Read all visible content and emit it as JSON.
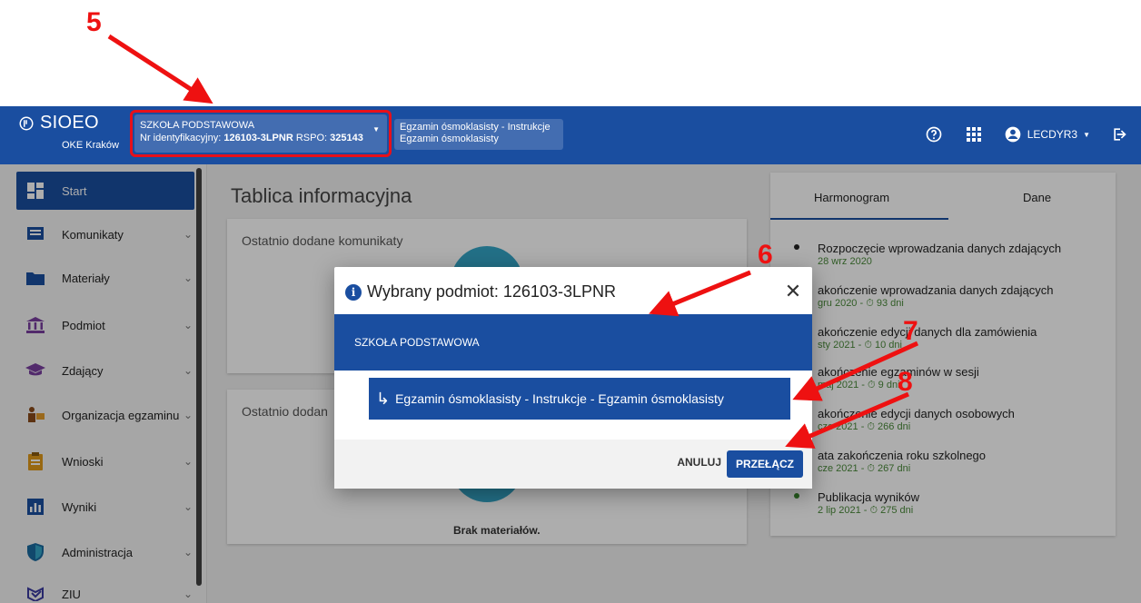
{
  "annotations": {
    "step5": "5",
    "step6": "6",
    "step7": "7",
    "step8": "8"
  },
  "header": {
    "brand": "SIOEO",
    "brand_sub": "OKE Kraków",
    "context": {
      "school_type": "SZKOŁA PODSTAWOWA",
      "id_label": "Nr identyfikacyjny:",
      "id_value": "126103-3LPNR",
      "rspo_label": "RSPO:",
      "rspo_value": "325143"
    },
    "exam_context": {
      "line1": "Egzamin ósmoklasisty - Instrukcje",
      "line2": "Egzamin ósmoklasisty"
    },
    "user": "LECDYR3"
  },
  "sidebar": {
    "items": [
      {
        "label": "Start"
      },
      {
        "label": "Komunikaty"
      },
      {
        "label": "Materiały"
      },
      {
        "label": "Podmiot"
      },
      {
        "label": "Zdający"
      },
      {
        "label": "Organizacja egzaminu"
      },
      {
        "label": "Wnioski"
      },
      {
        "label": "Wyniki"
      },
      {
        "label": "Administracja"
      },
      {
        "label": "ZIU"
      }
    ]
  },
  "main": {
    "title": "Tablica informacyjna",
    "card1_title": "Ostatnio dodane komunikaty",
    "card2_title": "Ostatnio dodan",
    "card2_empty": "Brak materiałów."
  },
  "schedule": {
    "tabs": [
      "Harmonogram",
      "Dane"
    ],
    "items": [
      {
        "title": "Rozpoczęcie wprowadzania danych zdających",
        "date": "28 wrz 2020"
      },
      {
        "title": "akończenie wprowadzania danych zdających",
        "date": "gru 2020 - ⏱ 93 dni"
      },
      {
        "title": "akończenie edycji danych dla zamówienia",
        "date": "sty 2021 - ⏱ 10 dni"
      },
      {
        "title": "akończenie egzaminów w sesji",
        "date": "maj 2021 - ⏱ 9 dni"
      },
      {
        "title": "akończenie edycji danych osobowych",
        "date": "cze 2021 - ⏱ 266 dni"
      },
      {
        "title": "ata zakończenia roku szkolnego",
        "date": "cze 2021 - ⏱ 267 dni"
      },
      {
        "title": "Publikacja wyników",
        "date": "2 lip 2021 - ⏱ 275 dni"
      }
    ]
  },
  "dialog": {
    "title": "Wybrany podmiot: 126103-3LPNR",
    "school": "SZKOŁA PODSTAWOWA",
    "exam": "Egzamin ósmoklasisty - Instrukcje - Egzamin ósmoklasisty",
    "cancel": "ANULUJ",
    "confirm": "PRZEŁĄCZ"
  }
}
